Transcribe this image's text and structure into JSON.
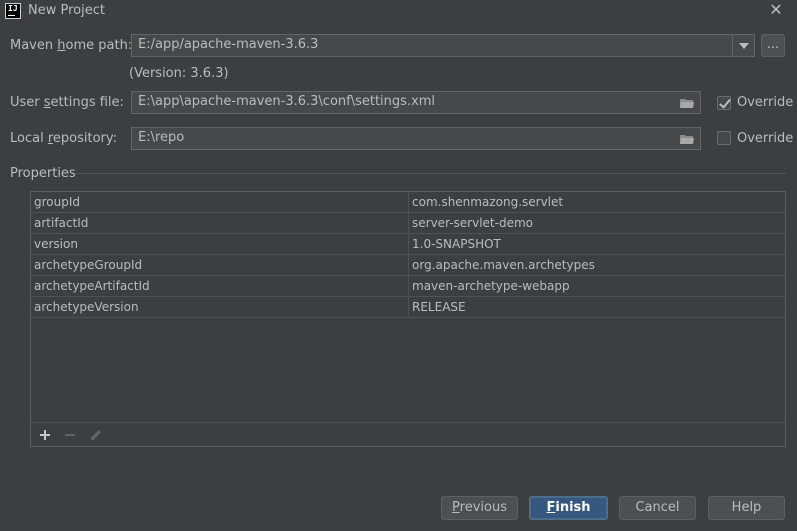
{
  "window": {
    "title": "New Project",
    "logo": "IJ"
  },
  "maven_home": {
    "label_pre": "Maven ",
    "label_mn": "h",
    "label_post": "ome path:",
    "value": "E:/app/apache-maven-3.6.3",
    "browse_label": "...",
    "version_text": "(Version: 3.6.3)"
  },
  "user_settings": {
    "label_pre": "User ",
    "label_mn": "s",
    "label_post": "ettings file:",
    "value": "E:\\app\\apache-maven-3.6.3\\conf\\settings.xml",
    "override_label": "Override",
    "override_checked": true
  },
  "local_repo": {
    "label_pre": "Local ",
    "label_mn": "r",
    "label_post": "epository:",
    "value": "E:\\repo",
    "override_label": "Override",
    "override_checked": false
  },
  "properties": {
    "title": "Properties",
    "rows": [
      {
        "key": "groupId",
        "value": "com.shenmazong.servlet"
      },
      {
        "key": "artifactId",
        "value": "server-servlet-demo"
      },
      {
        "key": "version",
        "value": "1.0-SNAPSHOT"
      },
      {
        "key": "archetypeGroupId",
        "value": "org.apache.maven.archetypes"
      },
      {
        "key": "archetypeArtifactId",
        "value": "maven-archetype-webapp"
      },
      {
        "key": "archetypeVersion",
        "value": "RELEASE"
      }
    ],
    "tools": [
      "add-icon",
      "remove-icon",
      "edit-icon"
    ]
  },
  "buttons": {
    "previous": {
      "mn": "P",
      "rest": "revious"
    },
    "finish": {
      "mn": "F",
      "rest": "inish"
    },
    "cancel": "Cancel",
    "help": "Help"
  }
}
